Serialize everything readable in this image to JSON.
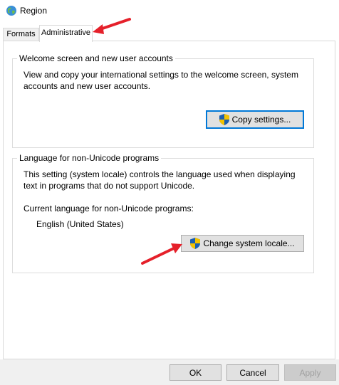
{
  "window": {
    "title": "Region"
  },
  "tabs": [
    {
      "label": "Formats"
    },
    {
      "label": "Administrative"
    }
  ],
  "welcome_group": {
    "legend": "Welcome screen and new user accounts",
    "description_line1": "View and copy your international settings to the welcome screen, system",
    "description_line2": "accounts and new user accounts.",
    "copy_button": "Copy settings..."
  },
  "unicode_group": {
    "legend": "Language for non-Unicode programs",
    "description_line1": "This setting (system locale) controls the language used when displaying",
    "description_line2": "text in programs that do not support Unicode.",
    "current_label": "Current language for non-Unicode programs:",
    "current_value": "English (United States)",
    "change_button": "Change system locale..."
  },
  "footer": {
    "ok": "OK",
    "cancel": "Cancel",
    "apply": "Apply"
  },
  "colors": {
    "accent": "#0078d7",
    "annotation_arrow": "#e5202a",
    "button_face": "#e1e1e1",
    "footer_bg": "#f0f0f0"
  }
}
